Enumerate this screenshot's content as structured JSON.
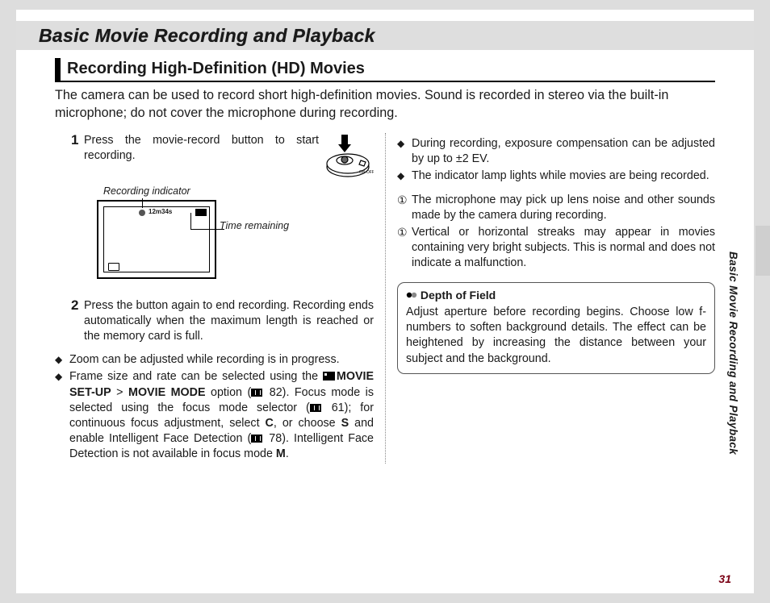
{
  "chapter_title": "Basic Movie Recording and Playback",
  "section_heading": "Recording High-Definition (HD) Movies",
  "intro": "The camera can be used to record short high-definition movies.  Sound is recorded in stereo via the built-in microphone; do not cover the microphone during recording.",
  "step1_text": "Press the movie-record button to start recording.",
  "indicator_label": "Recording indicator",
  "rec_time": "12m34s",
  "time_label": "Time remaining",
  "step2_text": "Press the button again to end recording.  Recording ends automatically when the maximum length is reached or the memory card is full.",
  "left_bullets": {
    "b1": "Zoom can be adjusted while recording is in progress.",
    "b2a": "Frame size and rate can be selected using the ",
    "b2_bold1": "MOVIE SET-UP",
    "b2_gt": " > ",
    "b2_bold2": "MOVIE MODE",
    "b2b": " option (",
    "b2_ref": " 82).  Focus mode is selected using the focus mode selector (",
    "b2_ref2": " 61); for continuous focus adjustment, select ",
    "b2_boldC": "C",
    "b2c": ", or choose ",
    "b2_boldS": "S",
    "b2d": " and enable Intelligent Face Detection (",
    "b2_ref3": " 78).  Intelligent Face Detection is not available in focus mode ",
    "b2_boldM": "M",
    "b2e": "."
  },
  "right_bullets": {
    "b1": "During recording, exposure compensation can be adjusted by up to ±2 EV.",
    "b2": "The indicator lamp lights while movies are being recorded."
  },
  "cautions": {
    "c1": "The microphone may pick up lens noise and other sounds made by the camera during recording.",
    "c2": "Vertical or horizontal streaks may appear in movies containing very bright subjects.  This is normal and does not indicate a malfunction."
  },
  "tip": {
    "title": "Depth of Field",
    "body": "Adjust aperture before recording begins.  Choose low f-numbers to soften background details.  The effect can be heightened by increasing the distance between your subject and the background."
  },
  "side_tab_text": "Basic Movie Recording and Playback",
  "page_number": "31"
}
